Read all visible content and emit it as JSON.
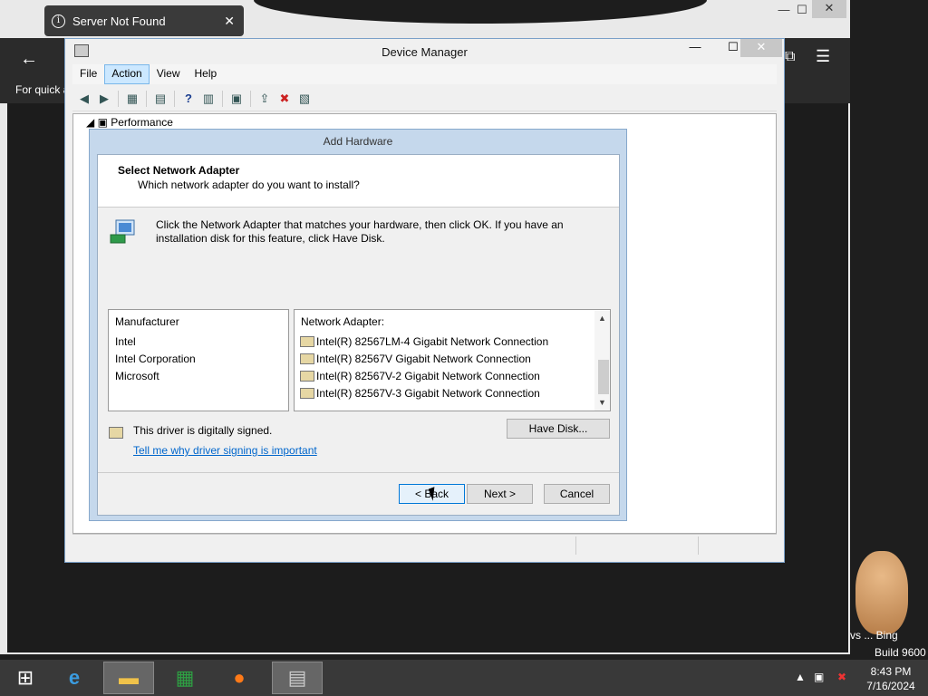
{
  "toast": {
    "text": "Server Not Found",
    "close": "✕"
  },
  "browser": {
    "quick_text": "For quick a",
    "back": "←",
    "forward": "→",
    "menu": "☰",
    "ext": "⧉"
  },
  "device_manager": {
    "title": "Device Manager",
    "menu": [
      "File",
      "Action",
      "View",
      "Help"
    ],
    "tree_item": "Performance"
  },
  "add_hardware": {
    "title": "Add Hardware",
    "heading": "Select Network Adapter",
    "subheading": "Which network adapter do you want to install?",
    "description": "Click the Network Adapter that matches your hardware, then click OK. If you have an installation disk for this feature, click Have Disk.",
    "manufacturer": {
      "header": "Manufacturer",
      "items": [
        "Intel",
        "Intel Corporation",
        "Microsoft"
      ]
    },
    "adapter": {
      "header": "Network Adapter:",
      "items": [
        "Intel(R) 82567LM-4 Gigabit Network Connection",
        "Intel(R) 82567V Gigabit Network Connection",
        "Intel(R) 82567V-2 Gigabit Network Connection",
        "Intel(R) 82567V-3 Gigabit Network Connection"
      ]
    },
    "signed_text": "This driver is digitally signed.",
    "signing_link": "Tell me why driver signing is important",
    "buttons": {
      "have_disk": "Have Disk...",
      "back": "< Back",
      "next": "Next >",
      "cancel": "Cancel"
    }
  },
  "desktop": {
    "bing_text": "vs ... Bing",
    "build": "Build 9600"
  },
  "taskbar": {
    "time": "8:43 PM",
    "date": "7/16/2024"
  }
}
